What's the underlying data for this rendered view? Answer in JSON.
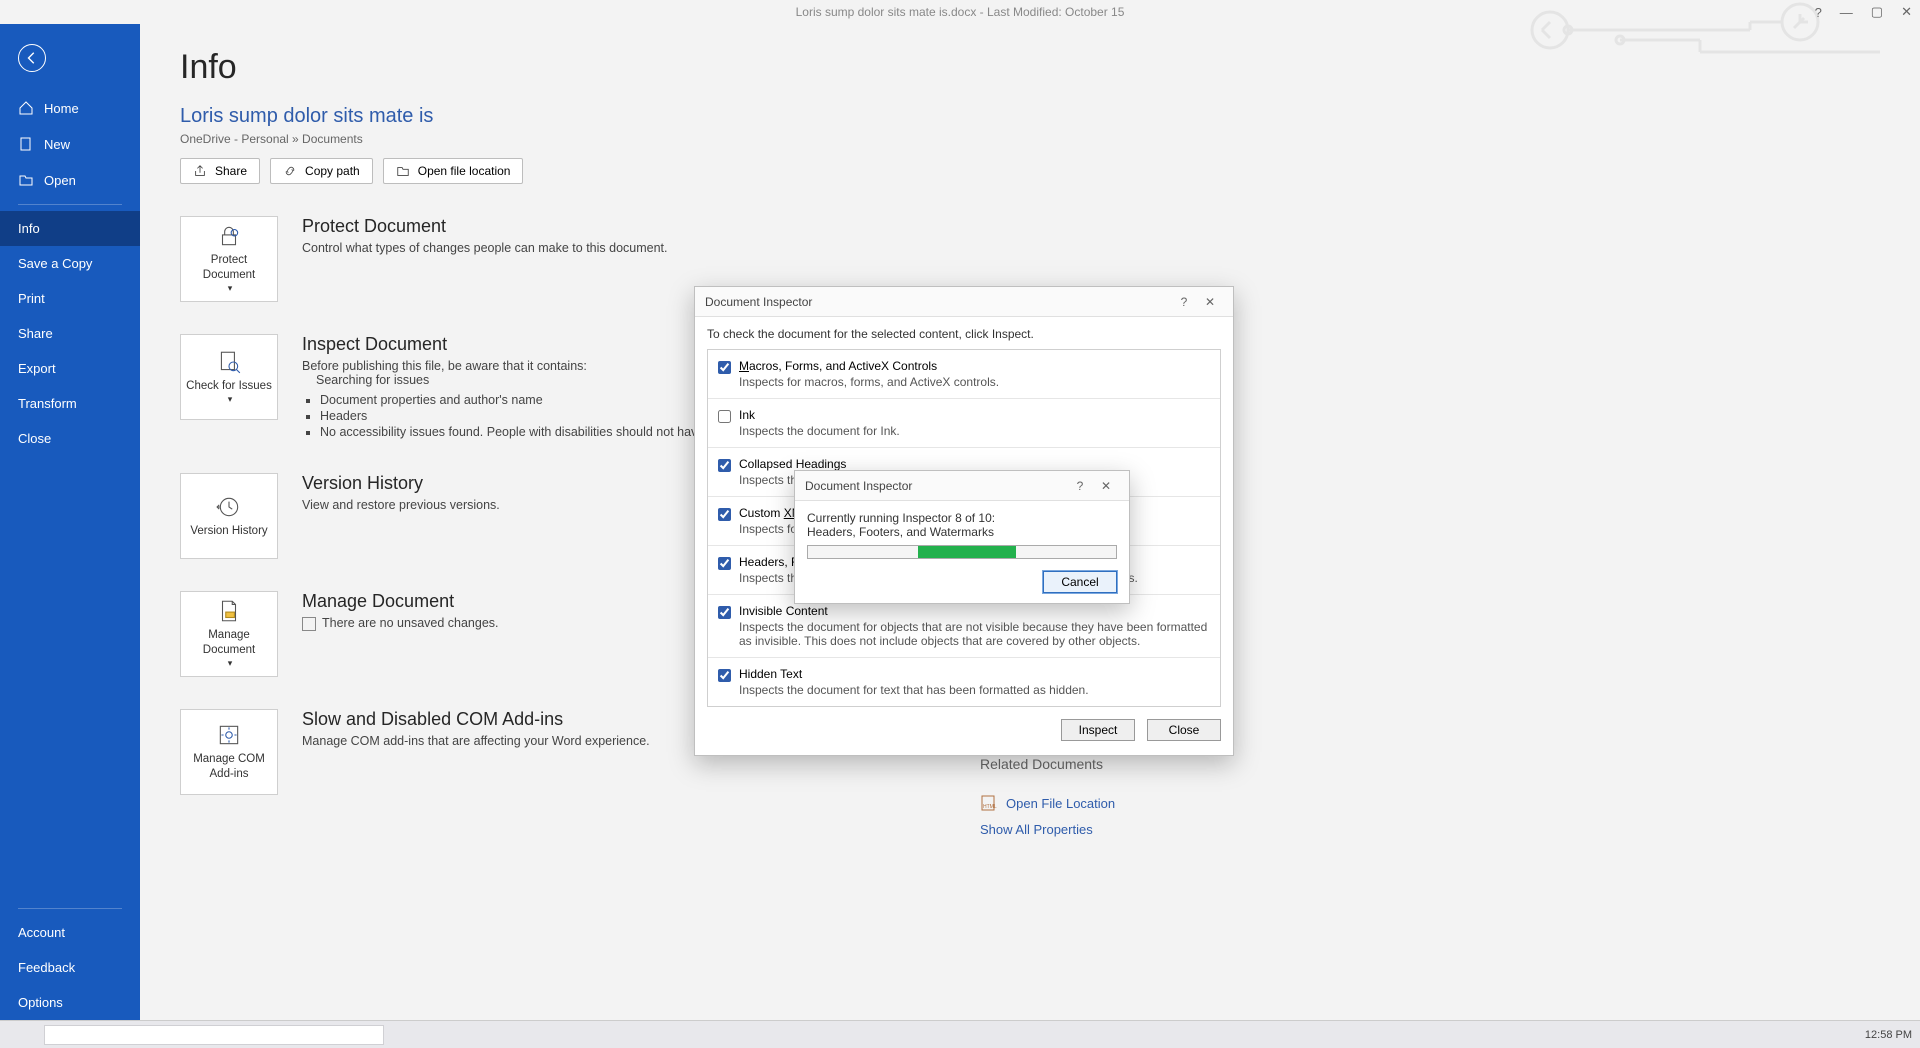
{
  "titlebar": {
    "center": "Loris sump dolor sits mate is.docx  -  Last Modified: October 15",
    "help": "?",
    "min": "—",
    "max": "▢",
    "close": "✕"
  },
  "sidebar": {
    "items": [
      {
        "label": "Home"
      },
      {
        "label": "New"
      },
      {
        "label": "Open"
      },
      {
        "label": "Info"
      },
      {
        "label": "Save a Copy"
      },
      {
        "label": "Print"
      },
      {
        "label": "Share"
      },
      {
        "label": "Export"
      },
      {
        "label": "Transform"
      },
      {
        "label": "Close"
      }
    ],
    "footer": [
      {
        "label": "Account"
      },
      {
        "label": "Feedback"
      },
      {
        "label": "Options"
      }
    ]
  },
  "page": {
    "title": "Info",
    "doc_title": "Loris sump dolor sits mate is",
    "doc_path": "OneDrive - Personal » Documents",
    "buttons": {
      "share": "Share",
      "copy_path": "Copy path",
      "open_loc": "Open file location"
    }
  },
  "sections": {
    "protect": {
      "tile": "Protect Document",
      "heading": "Protect Document",
      "body": "Control what types of changes people can make to this document."
    },
    "inspect": {
      "tile": "Check for Issues",
      "heading": "Inspect Document",
      "intro": "Before publishing this file, be aware that it contains:",
      "lines": [
        "Searching for issues",
        "Document properties and author's name",
        "Headers",
        "No accessibility issues found. People with disabilities should not have difficulty reading this document."
      ]
    },
    "version": {
      "tile": "Version History",
      "heading": "Version History",
      "body": "View and restore previous versions."
    },
    "manage": {
      "tile": "Manage Document",
      "heading": "Manage Document",
      "body": "There are no unsaved changes."
    },
    "com": {
      "tile": "Manage COM Add-ins",
      "heading": "Slow and Disabled COM Add-ins",
      "body": "Manage COM add-ins that are affecting your Word experience."
    }
  },
  "rightcol": {
    "related_docs": "Related Documents",
    "open_file_loc": "Open File Location",
    "show_all": "Show All Properties"
  },
  "dialog": {
    "title": "Document Inspector",
    "help": "?",
    "close": "✕",
    "instruction": "To check the document for the selected content, click Inspect.",
    "rows": [
      {
        "checked": true,
        "title": "Macros, Forms, and ActiveX Controls",
        "u": "M",
        "desc": "Inspects for macros, forms, and ActiveX controls."
      },
      {
        "checked": false,
        "title": "Ink",
        "u": "",
        "desc": "Inspects the document for Ink."
      },
      {
        "checked": true,
        "title": "Collapsed Headings",
        "u": "",
        "desc": "Inspects the document for text that has been collapsed under a heading."
      },
      {
        "checked": true,
        "title": "Custom XML Data",
        "u": "XM",
        "desc": "Inspects for custom XML data stored with this document."
      },
      {
        "checked": true,
        "title": "Headers, Footers, and Watermarks",
        "u": "",
        "desc": "Inspects the document for information in headers, footers, and watermarks."
      },
      {
        "checked": true,
        "title": "Invisible Content",
        "u": "",
        "desc": "Inspects the document for objects that are not visible because they have been formatted as invisible. This does not include objects that are covered by other objects."
      },
      {
        "checked": true,
        "title": "Hidden Text",
        "u": "",
        "desc": "Inspects the document for text that has been formatted as hidden."
      }
    ],
    "inspect_btn": "Inspect",
    "close_btn": "Close"
  },
  "progress": {
    "title": "Document Inspector",
    "help": "?",
    "close": "✕",
    "line1": "Currently running Inspector 8 of 10:",
    "line2": "Headers, Footers, and Watermarks",
    "cancel": "Cancel"
  },
  "taskbar": {
    "time": "12:58 PM"
  },
  "chart_data": null
}
